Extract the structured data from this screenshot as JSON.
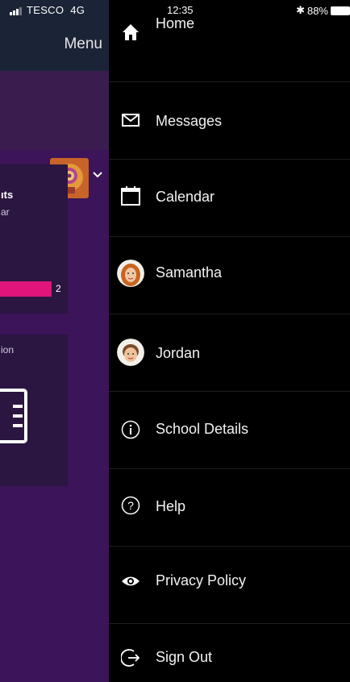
{
  "status_bar": {
    "carrier": "TESCO",
    "network": "4G",
    "time": "12:35",
    "bluetooth": "✱",
    "battery": "88%"
  },
  "behind": {
    "menu_title": "Menu",
    "card1": {
      "title": "ıts",
      "subtitle": "ar",
      "bar_value": "2"
    },
    "card2": {
      "title": "ion"
    }
  },
  "drawer": {
    "items": [
      {
        "label": "Home",
        "icon": "home-icon"
      },
      {
        "label": "Messages",
        "icon": "envelope-icon"
      },
      {
        "label": "Calendar",
        "icon": "calendar-icon"
      },
      {
        "label": "Samantha",
        "icon": "avatar-samantha"
      },
      {
        "label": "Jordan",
        "icon": "avatar-jordan"
      },
      {
        "label": "School Details",
        "icon": "info-icon"
      },
      {
        "label": "Help",
        "icon": "help-icon"
      },
      {
        "label": "Privacy Policy",
        "icon": "eye-icon"
      },
      {
        "label": "Sign Out",
        "icon": "sign-out-icon"
      }
    ]
  },
  "colors": {
    "background_app": "#3b1459",
    "drawer": "#000000",
    "accent": "#e0147a"
  }
}
